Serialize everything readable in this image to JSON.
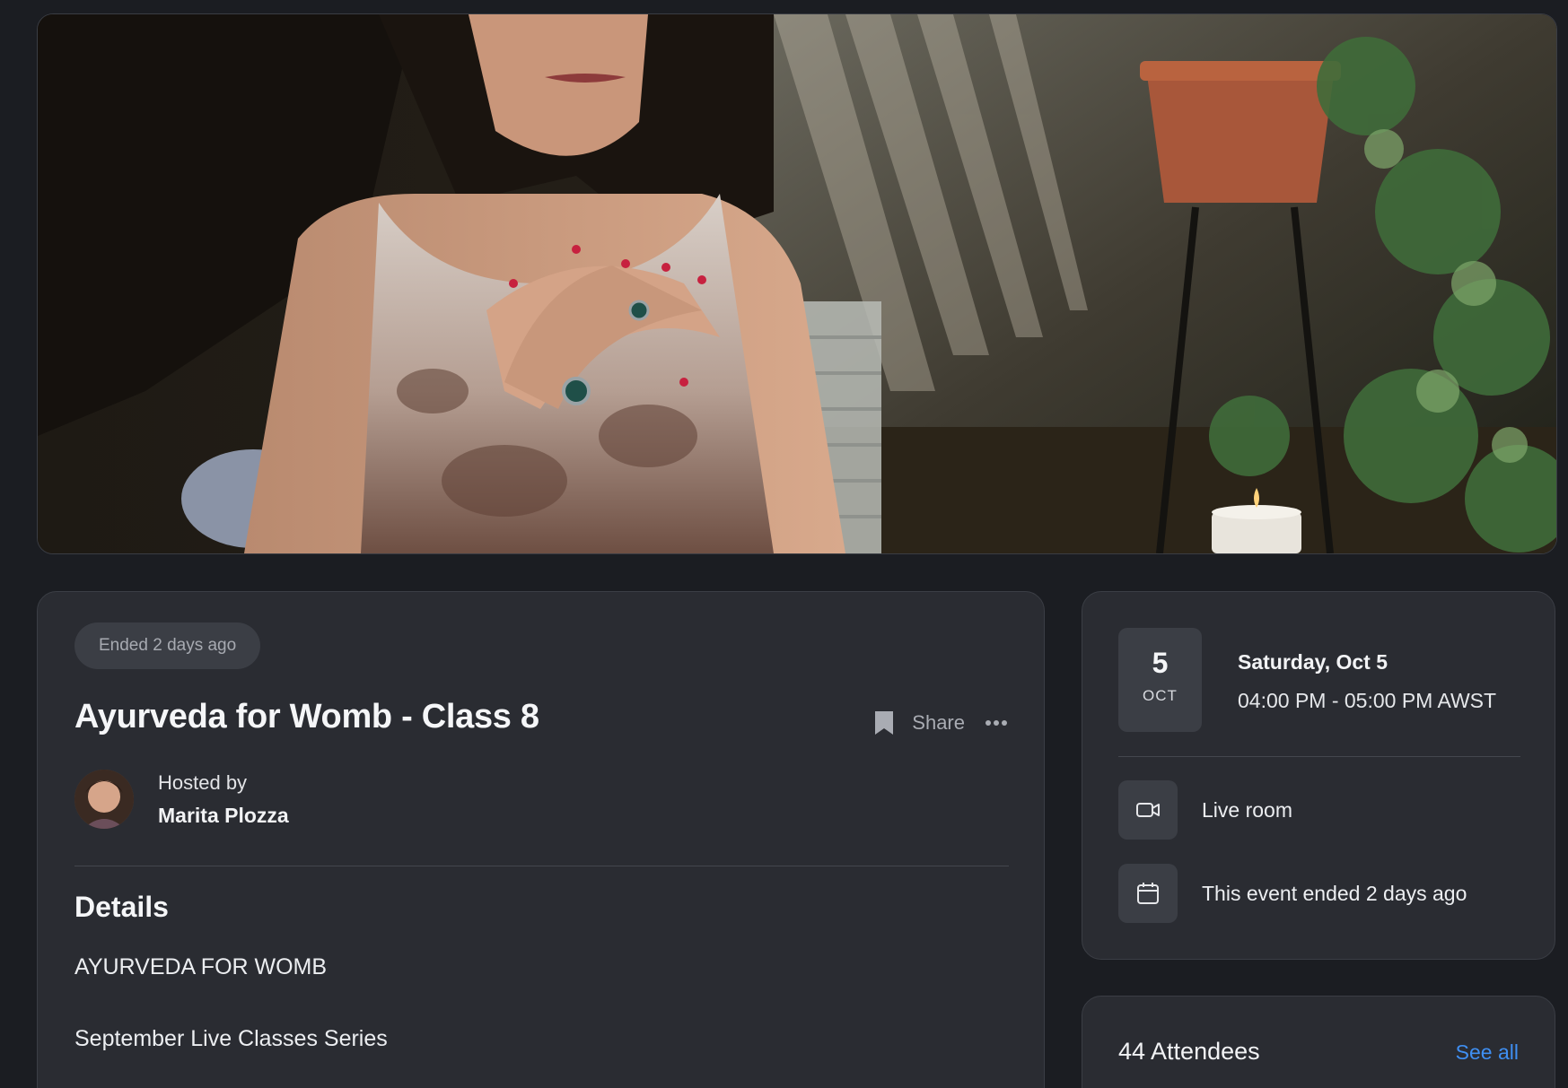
{
  "hero": {
    "image_alt": "Woman with hands crossed over her chest in a shaded garden"
  },
  "event": {
    "status": "Ended 2 days ago",
    "title": "Ayurveda for Womb - Class 8",
    "share_label": "Share",
    "host": {
      "label": "Hosted by",
      "name": "Marita Plozza"
    },
    "details": {
      "heading": "Details",
      "lines": [
        "AYURVEDA FOR WOMB",
        "September Live Classes Series"
      ]
    }
  },
  "date_card": {
    "day": "5",
    "month": "OCT",
    "date_long": "Saturday, Oct 5",
    "time_range": "04:00 PM - 05:00 PM AWST",
    "location": "Live room",
    "ended_text": "This event ended 2 days ago"
  },
  "attendees": {
    "title": "44 Attendees",
    "see_all": "See all"
  },
  "colors": {
    "background": "#1b1d22",
    "card": "#2a2c32",
    "accent_link": "#3f8ff2"
  },
  "icons": {
    "bookmark": "bookmark-icon",
    "more": "more-horizontal-icon",
    "video": "video-camera-icon",
    "calendar": "calendar-icon"
  }
}
